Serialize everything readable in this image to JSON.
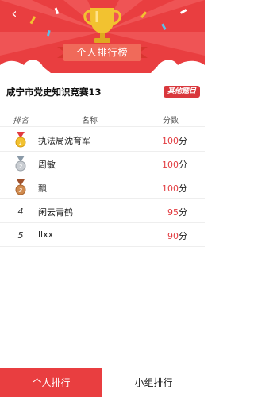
{
  "header": {
    "back_icon": "chevron-left-icon",
    "title": "个人排行榜",
    "colors": {
      "bg": "#e93e40",
      "ribbon": "#f06a5a",
      "gold": "#f2c230"
    }
  },
  "contest": {
    "title": "咸宁市党史知识竞赛13",
    "other_button": "其他题目"
  },
  "table": {
    "headers": {
      "rank": "排名",
      "name": "名称",
      "score": "分数"
    },
    "rows": [
      {
        "rank": "1",
        "medal": "gold-medal-icon",
        "name": "执法局沈育军",
        "score": "100",
        "unit": "分"
      },
      {
        "rank": "2",
        "medal": "silver-medal-icon",
        "name": "周敏",
        "score": "100",
        "unit": "分"
      },
      {
        "rank": "3",
        "medal": "bronze-medal-icon",
        "name": "飘",
        "score": "100",
        "unit": "分"
      },
      {
        "rank": "4",
        "medal": "",
        "name": "闲云青鹤",
        "score": "95",
        "unit": "分"
      },
      {
        "rank": "5",
        "medal": "",
        "name": "llxx",
        "score": "90",
        "unit": "分"
      }
    ]
  },
  "tabs": [
    {
      "label": "个人排行",
      "active": true
    },
    {
      "label": "小组排行",
      "active": false
    }
  ]
}
